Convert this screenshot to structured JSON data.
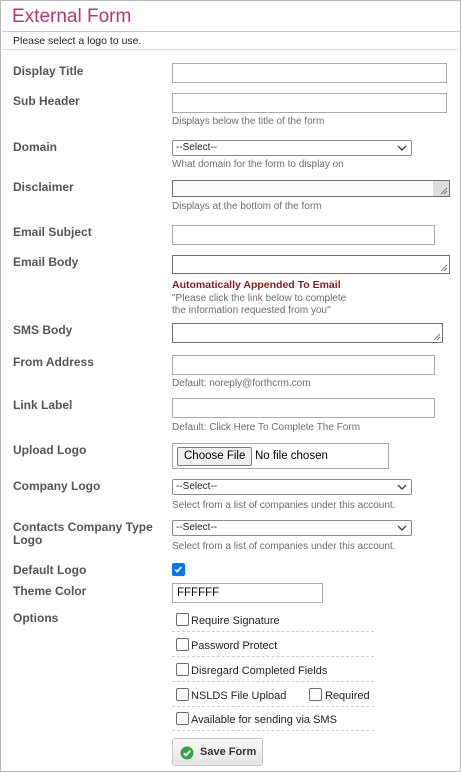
{
  "header": {
    "title": "External Form",
    "notice": "Please select a logo to use."
  },
  "fields": {
    "display_title": {
      "label": "Display Title",
      "value": ""
    },
    "sub_header": {
      "label": "Sub Header",
      "value": "",
      "hint": "Displays below the title of the form"
    },
    "domain": {
      "label": "Domain",
      "selected": "--Select--",
      "hint": "What domain for the form to display on"
    },
    "disclaimer": {
      "label": "Disclaimer",
      "value": "",
      "hint": "Displays at the bottom of the form"
    },
    "email_subject": {
      "label": "Email Subject",
      "value": ""
    },
    "email_body": {
      "label": "Email Body",
      "value": "",
      "note": "Automatically Appended To Email",
      "hint_line1": "\"Please click the link below to complete",
      "hint_line2": "the information requested from you\""
    },
    "sms_body": {
      "label": "SMS Body",
      "value": ""
    },
    "from_address": {
      "label": "From Address",
      "value": "",
      "hint": "Default: noreply@forthcrm.com"
    },
    "link_label": {
      "label": "Link Label",
      "value": "",
      "hint": "Default: Click Here To Complete The Form"
    },
    "upload_logo": {
      "label": "Upload Logo",
      "button": "Choose File",
      "status": "No file chosen"
    },
    "company_logo": {
      "label": "Company Logo",
      "selected": "--Select--",
      "hint": "Select from a list of companies under this account."
    },
    "contacts_company_type_logo": {
      "label_line1": "Contacts Company Type",
      "label_line2": "Logo",
      "selected": "--Select--",
      "hint": "Select from a list of companies under this account."
    },
    "default_logo": {
      "label": "Default Logo",
      "checked": true
    },
    "theme_color": {
      "label": "Theme Color",
      "value": "FFFFFF"
    }
  },
  "options": {
    "label": "Options",
    "require_signature": {
      "label": "Require Signature",
      "checked": false
    },
    "password_protect": {
      "label": "Password Protect",
      "checked": false
    },
    "disregard_completed": {
      "label": "Disregard Completed Fields",
      "checked": false
    },
    "nslds_file_upload": {
      "label": "NSLDS File Upload",
      "checked": false
    },
    "required": {
      "label": "Required",
      "checked": false
    },
    "available_sms": {
      "label": "Available for sending via SMS",
      "checked": false
    }
  },
  "actions": {
    "save_label": "Save Form"
  },
  "colors": {
    "title": "#b5367f",
    "note": "#8b1a1a",
    "checkbox_checked": "#0075ff",
    "save_icon": "#3aa14a"
  },
  "icons": {
    "select": "chevron-down-icon",
    "save": "check-circle-icon",
    "resize": "resize-grip-icon",
    "checkmark": "checkmark-icon"
  }
}
